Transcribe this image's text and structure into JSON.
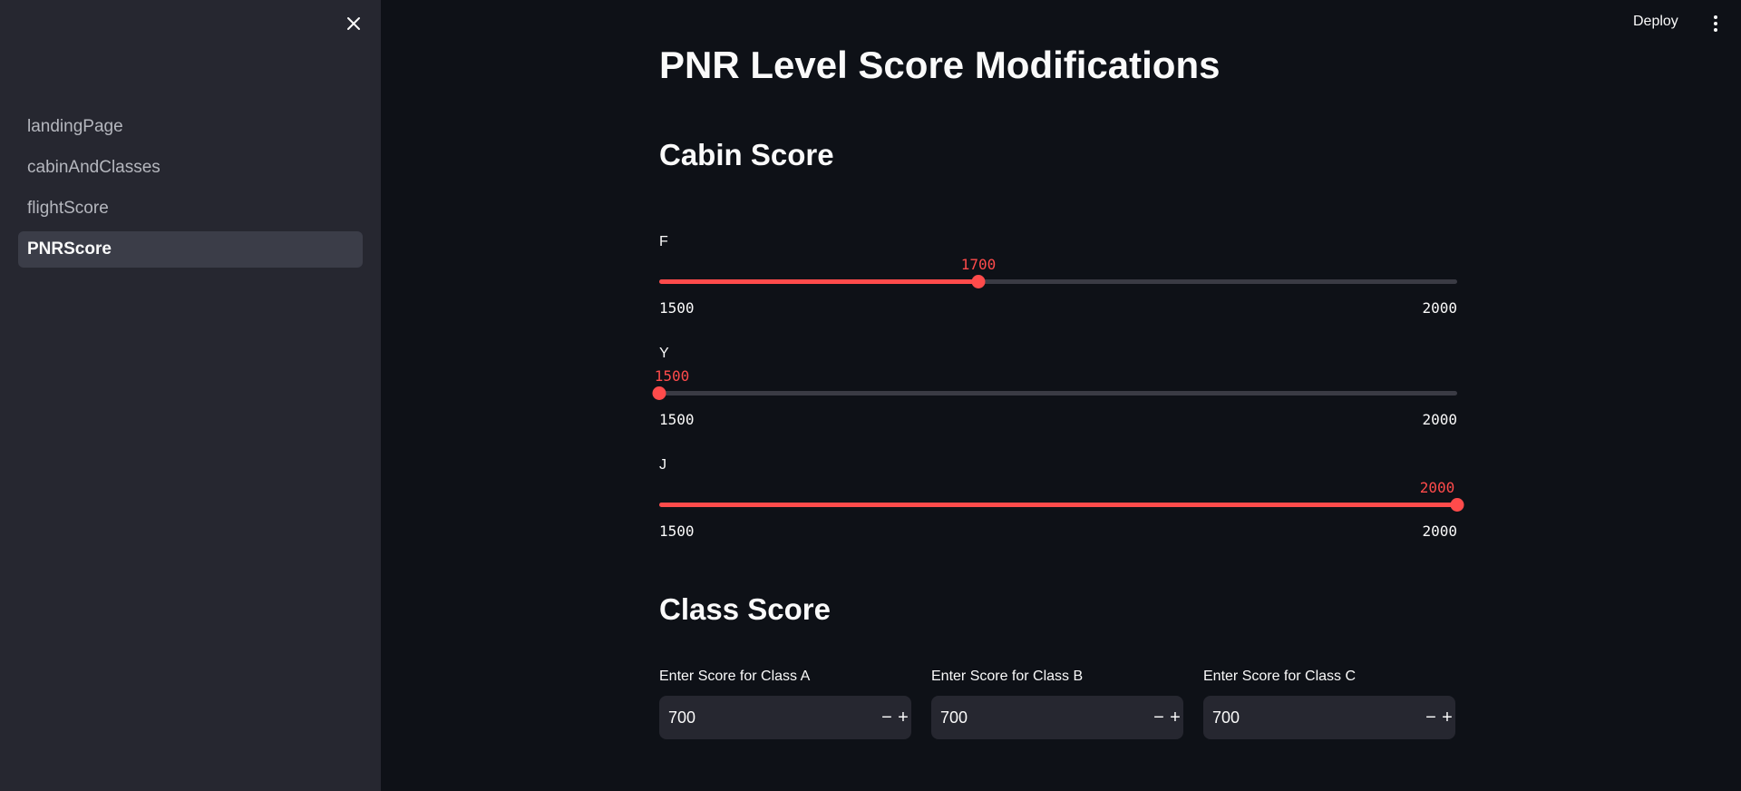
{
  "header": {
    "deploy_label": "Deploy",
    "menu_icon": "kebab-menu-icon"
  },
  "sidebar": {
    "close_icon": "close-icon",
    "items": [
      {
        "label": "landingPage",
        "active": false
      },
      {
        "label": "cabinAndClasses",
        "active": false
      },
      {
        "label": "flightScore",
        "active": false
      },
      {
        "label": "PNRScore",
        "active": true
      }
    ]
  },
  "main": {
    "title": "PNR Level Score Modifications",
    "cabin_heading": "Cabin Score",
    "sliders": [
      {
        "label": "F",
        "value": 1700,
        "min": 1500,
        "max": 2000,
        "value_text": "1700",
        "min_text": "1500",
        "max_text": "2000"
      },
      {
        "label": "Y",
        "value": 1500,
        "min": 1500,
        "max": 2000,
        "value_text": "1500",
        "min_text": "1500",
        "max_text": "2000"
      },
      {
        "label": "J",
        "value": 2000,
        "min": 1500,
        "max": 2000,
        "value_text": "2000",
        "min_text": "1500",
        "max_text": "2000"
      }
    ],
    "class_heading": "Class Score",
    "number_inputs": [
      {
        "label": "Enter Score for Class A",
        "value": "700",
        "minus": "−",
        "plus": "+"
      },
      {
        "label": "Enter Score for Class B",
        "value": "700",
        "minus": "−",
        "plus": "+"
      },
      {
        "label": "Enter Score for Class C",
        "value": "700",
        "minus": "−",
        "plus": "+"
      }
    ]
  },
  "colors": {
    "accent": "#ff4b4b",
    "background": "#0e1117",
    "sidebar": "#262730"
  }
}
